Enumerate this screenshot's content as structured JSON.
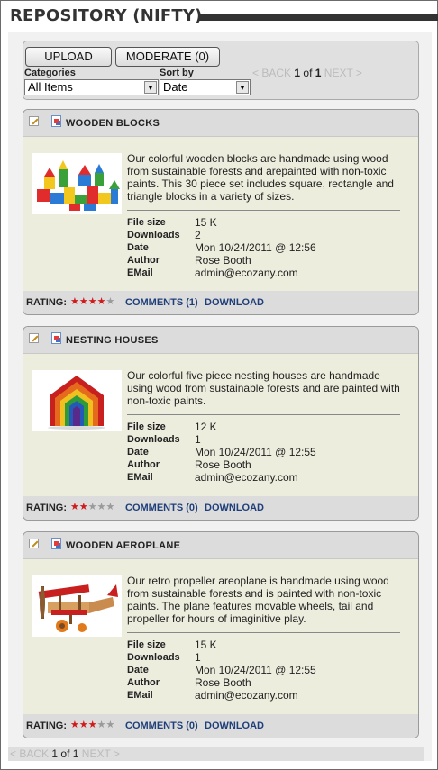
{
  "page": {
    "title": "REPOSITORY (NIFTY)"
  },
  "toolbar": {
    "upload_label": "UPLOAD",
    "moderate_label": "MODERATE (0)",
    "categories_label": "Categories",
    "categories_value": "All Items",
    "sort_label": "Sort by",
    "sort_value": "Date"
  },
  "pager_top": {
    "back": "< BACK",
    "current": "1",
    "of": "of",
    "total": "1",
    "next": "NEXT >"
  },
  "pager_bottom": {
    "back": "< BACK",
    "current": "1",
    "of": "of",
    "total": "1",
    "next": "NEXT >"
  },
  "labels": {
    "file_size": "File size",
    "downloads": "Downloads",
    "date": "Date",
    "author": "Author",
    "email": "EMail",
    "rating": "RATING:",
    "download": "DOWNLOAD"
  },
  "items": [
    {
      "title": "WOODEN BLOCKS",
      "description": "Our colorful wooden blocks are handmade using wood from sustainable forests and arepainted with non-toxic paints. This 30 piece set includes square, rectangle and triangle blocks in a variety of sizes.",
      "file_size": "15 K",
      "downloads": "2",
      "date": "Mon 10/24/2011 @ 12:56",
      "author": "Rose Booth",
      "email": "admin@ecozany.com",
      "rating": 4,
      "rating_max": 5,
      "comments": "COMMENTS (1)"
    },
    {
      "title": "NESTING HOUSES",
      "description": "Our colorful five piece nesting houses are handmade using wood from sustainable forests and are painted with non-toxic paints.",
      "file_size": "12 K",
      "downloads": "1",
      "date": "Mon 10/24/2011 @ 12:55",
      "author": "Rose Booth",
      "email": "admin@ecozany.com",
      "rating": 2,
      "rating_max": 5,
      "comments": "COMMENTS (0)"
    },
    {
      "title": "WOODEN AEROPLANE",
      "description": "Our retro propeller areoplane is handmade using wood from sustainable forests and is painted with non-toxic paints. The plane features movable wheels, tail and propeller for hours of imaginitive play.",
      "file_size": "15 K",
      "downloads": "1",
      "date": "Mon 10/24/2011 @ 12:55",
      "author": "Rose Booth",
      "email": "admin@ecozany.com",
      "rating": 3,
      "rating_max": 5,
      "comments": "COMMENTS (0)"
    }
  ],
  "colors": {
    "star_on": "#d21a1a",
    "star_off": "#9a9a9a",
    "link": "#1f3f7a"
  },
  "icons": [
    "edit-icon",
    "document-icon",
    "dropdown-arrow-icon",
    "star-icon"
  ]
}
